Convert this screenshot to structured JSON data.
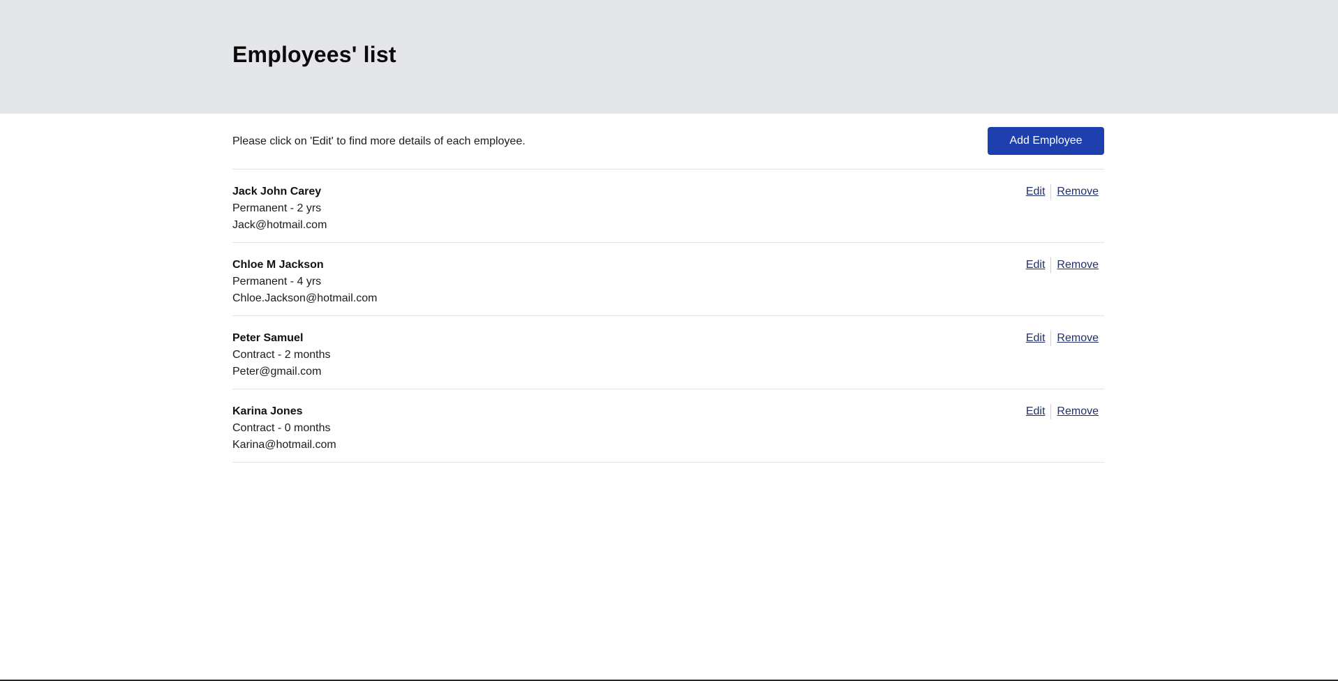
{
  "header": {
    "title": "Employees' list"
  },
  "intro": {
    "text": "Please click on 'Edit' to find more details of each employee.",
    "add_button_label": "Add Employee"
  },
  "actions": {
    "edit_label": "Edit",
    "remove_label": "Remove"
  },
  "colors": {
    "header_bg": "#e5e6ea",
    "accent": "#1e40af",
    "link": "#1f2f6b"
  },
  "employees": [
    {
      "name": "Jack John Carey",
      "employment": "Permanent - 2 yrs",
      "email": "Jack@hotmail.com"
    },
    {
      "name": "Chloe M Jackson",
      "employment": "Permanent - 4 yrs",
      "email": "Chloe.Jackson@hotmail.com"
    },
    {
      "name": "Peter Samuel",
      "employment": "Contract - 2 months",
      "email": "Peter@gmail.com"
    },
    {
      "name": "Karina Jones",
      "employment": "Contract - 0 months",
      "email": "Karina@hotmail.com"
    }
  ]
}
